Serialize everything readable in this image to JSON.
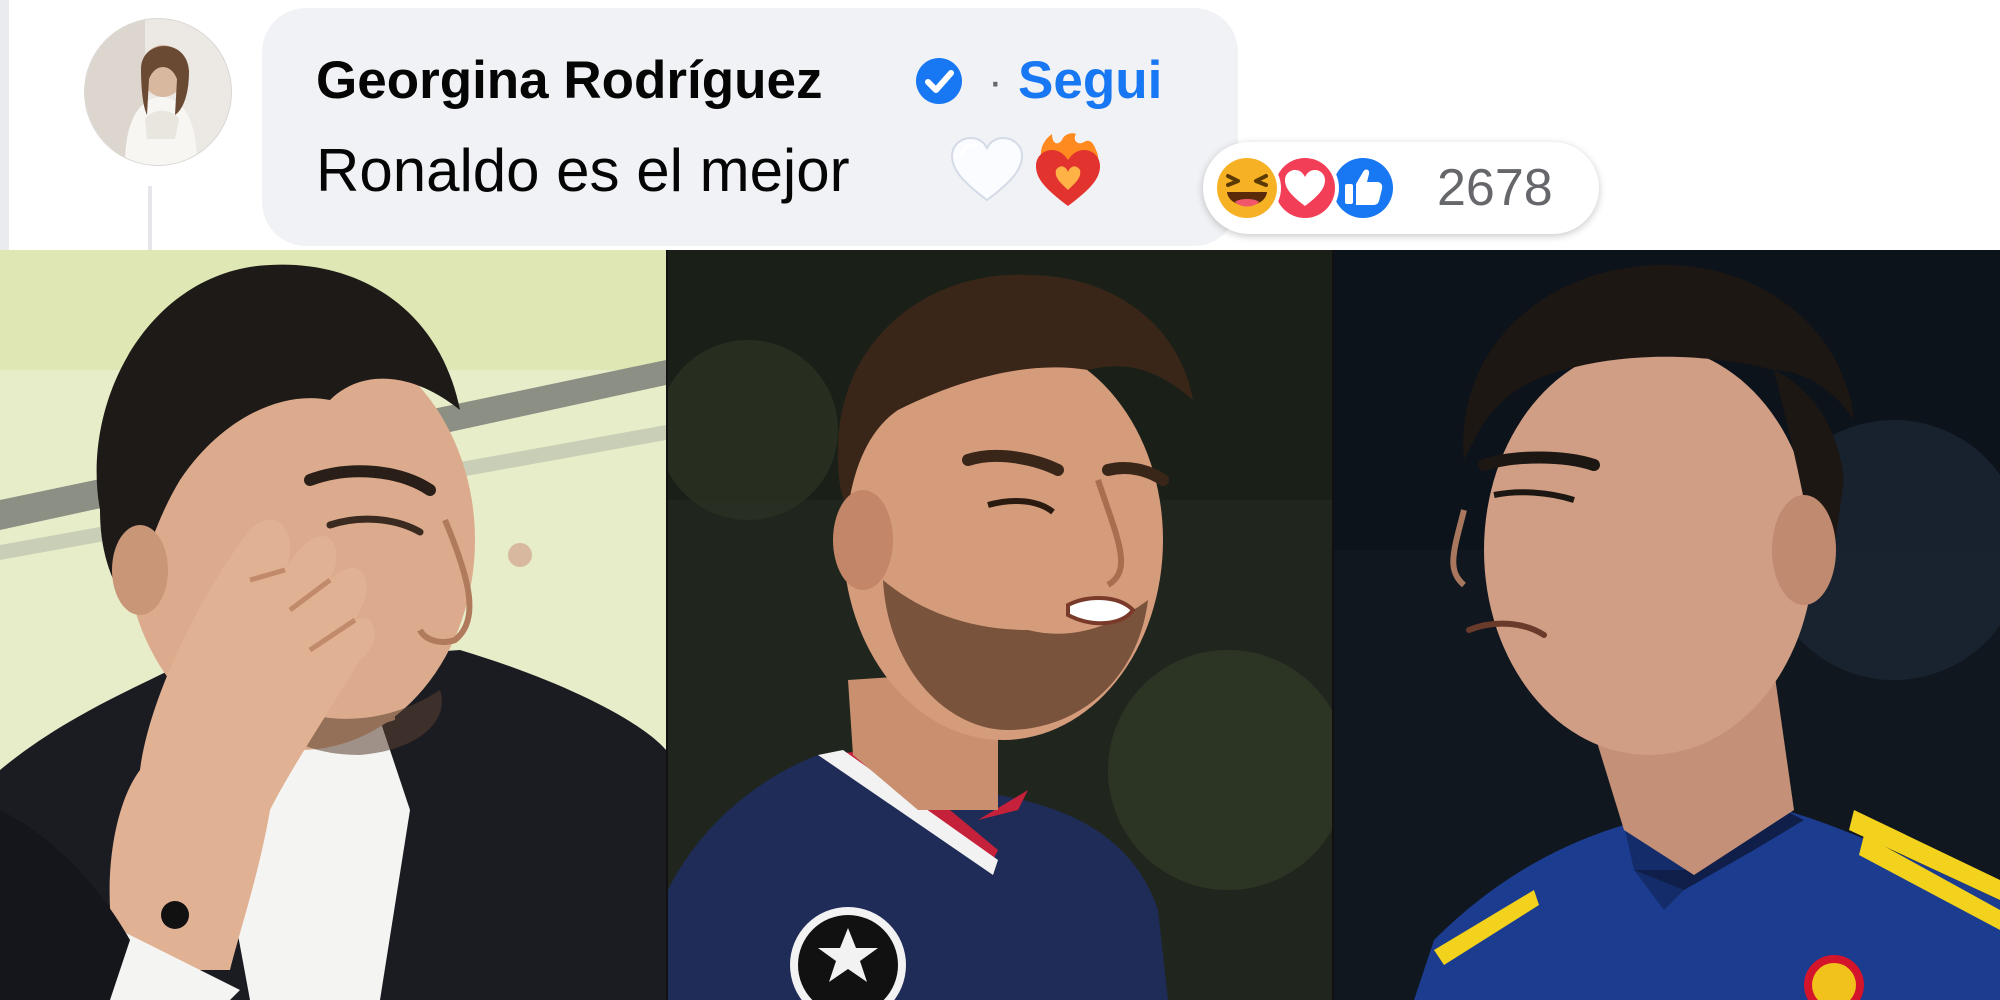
{
  "comment": {
    "author": "Georgina Rodríguez",
    "separator": "·",
    "follow_label": "Segui",
    "text": "Ronaldo es el mejor",
    "verified_icon": "verified-badge-icon",
    "emojis": [
      "white-heart-icon",
      "heart-on-fire-icon"
    ]
  },
  "reactions": {
    "icons": [
      "haha-reaction-icon",
      "love-reaction-icon",
      "like-reaction-icon"
    ],
    "count": "2678"
  },
  "colors": {
    "link_blue": "#1877f2",
    "bubble_bg": "#f0f2f5",
    "secondary_text": "#65676b",
    "love_red": "#f33e58",
    "haha_yellow": "#f7b125"
  },
  "photos": [
    {
      "subject": "man-in-suit-wiping-eye"
    },
    {
      "subject": "footballer-in-navy-jersey-grimacing"
    },
    {
      "subject": "footballer-in-blue-yellow-jersey"
    }
  ]
}
